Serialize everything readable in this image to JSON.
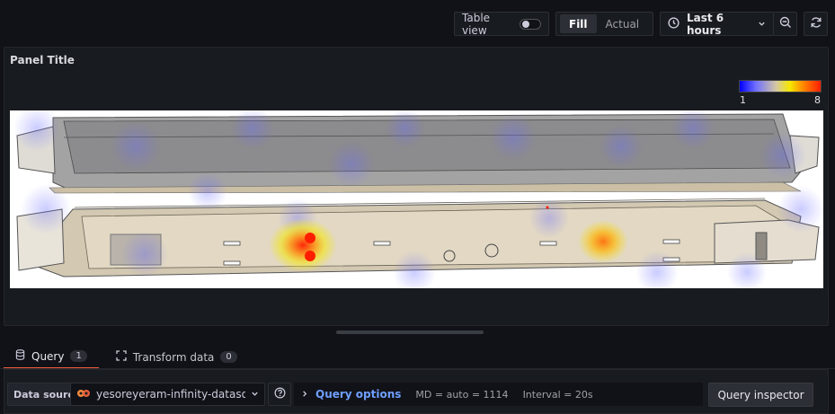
{
  "toolbar": {
    "table_view_label": "Table view",
    "fill_label": "Fill",
    "actual_label": "Actual",
    "time_range_label": "Last 6 hours"
  },
  "panel": {
    "title": "Panel Title",
    "legend": {
      "min_label": "1",
      "max_label": "8"
    }
  },
  "tabs": [
    {
      "label": "Query",
      "count": "1"
    },
    {
      "label": "Transform data",
      "count": "0"
    }
  ],
  "query_row": {
    "data_source_label": "Data source",
    "data_source_value": "yesoreyeram-infinity-datasour",
    "query_options_label": "Query options",
    "md_text": "MD = auto = 1114",
    "interval_text": "Interval = 20s",
    "inspector_label": "Query inspector"
  },
  "icons": {
    "clock": "clock-icon",
    "chevron": "chevron-down-icon",
    "zoom_out": "zoom-out-icon",
    "refresh": "refresh-icon",
    "database": "database-icon",
    "transform": "transform-icon",
    "help": "help-icon",
    "chevron_right": "chevron-right-icon"
  }
}
